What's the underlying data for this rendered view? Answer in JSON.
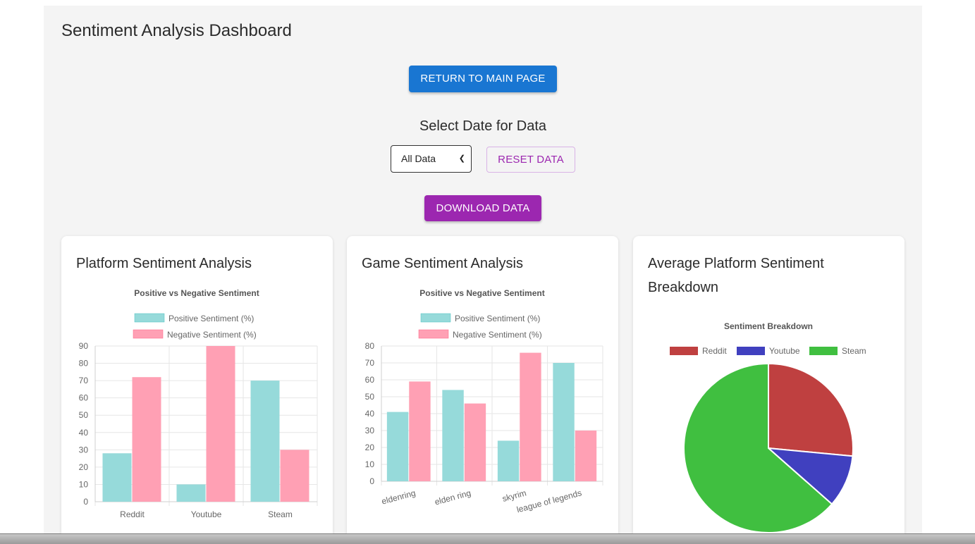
{
  "header": {
    "title": "Sentiment Analysis Dashboard"
  },
  "actions": {
    "return_label": "RETURN TO MAIN PAGE",
    "select_date_label": "Select Date for Data",
    "date_value": "All Data",
    "reset_label": "RESET DATA",
    "download_label": "DOWNLOAD DATA"
  },
  "cards": [
    {
      "title": "Platform Sentiment Analysis"
    },
    {
      "title": "Game Sentiment Analysis"
    },
    {
      "title": "Average Platform Sentiment Breakdown"
    }
  ],
  "colors": {
    "primary": "#1976d2",
    "secondary": "#9c27b0",
    "positive_fill": "#96dada",
    "negative_fill": "#ffa0b4",
    "reddit": "#bf4040",
    "youtube": "#4040bf",
    "steam": "#40bf40"
  },
  "chart_data": [
    {
      "type": "bar",
      "title": "Positive vs Negative Sentiment",
      "categories": [
        "Reddit",
        "Youtube",
        "Steam"
      ],
      "series": [
        {
          "name": "Positive Sentiment (%)",
          "values": [
            28,
            10,
            70
          ]
        },
        {
          "name": "Negative Sentiment (%)",
          "values": [
            72,
            90,
            30
          ]
        }
      ],
      "ylim": [
        0,
        90
      ],
      "yticks": [
        0,
        10,
        20,
        30,
        40,
        50,
        60,
        70,
        80,
        90
      ],
      "legend": "top",
      "grid": true
    },
    {
      "type": "bar",
      "title": "Positive vs Negative Sentiment",
      "categories": [
        "eldenring",
        "elden ring",
        "skyrim",
        "league of legends"
      ],
      "series": [
        {
          "name": "Positive Sentiment (%)",
          "values": [
            41,
            54,
            24,
            70
          ]
        },
        {
          "name": "Negative Sentiment (%)",
          "values": [
            59,
            46,
            76,
            30
          ]
        }
      ],
      "ylim": [
        0,
        80
      ],
      "yticks": [
        0,
        10,
        20,
        30,
        40,
        50,
        60,
        70,
        80
      ],
      "legend": "top",
      "grid": true
    },
    {
      "type": "pie",
      "title": "Sentiment Breakdown",
      "labels": [
        "Reddit",
        "Youtube",
        "Steam"
      ],
      "values": [
        26.5,
        10,
        63.5
      ],
      "legend": "top"
    }
  ]
}
